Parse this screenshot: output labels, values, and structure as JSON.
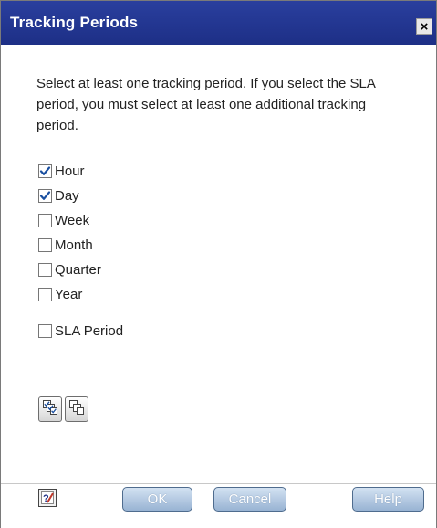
{
  "dialog": {
    "title": "Tracking Periods",
    "close_label": "×",
    "instructions": "Select at least one tracking period. If you select the SLA period, you must select at least one additional tracking period."
  },
  "periods": [
    {
      "label": "Hour",
      "checked": true
    },
    {
      "label": "Day",
      "checked": true
    },
    {
      "label": "Week",
      "checked": false
    },
    {
      "label": "Month",
      "checked": false
    },
    {
      "label": "Quarter",
      "checked": false
    },
    {
      "label": "Year",
      "checked": false
    }
  ],
  "sla_period": {
    "label": "SLA Period",
    "checked": false
  },
  "selection_buttons": {
    "select_all_icon": "select-all-icon",
    "clear_all_icon": "clear-all-icon"
  },
  "footer": {
    "help_icon": "context-help-icon",
    "ok_label": "OK",
    "cancel_label": "Cancel",
    "help_label": "Help"
  },
  "colors": {
    "titlebar": "#1d2f86",
    "button": "#98b3d3",
    "checkmark": "#1a4fa0"
  }
}
